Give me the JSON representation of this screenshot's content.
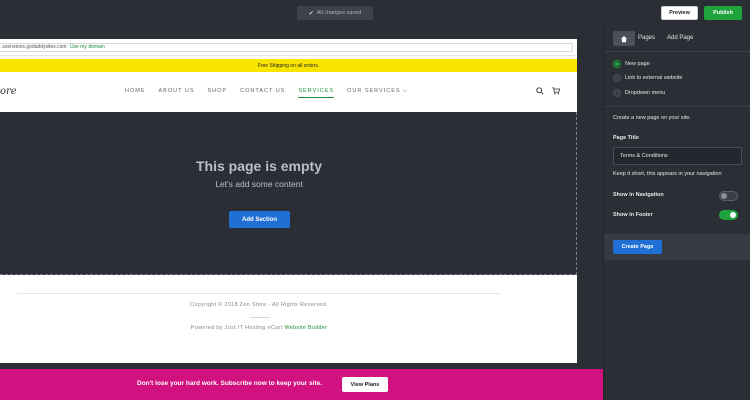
{
  "topbar": {
    "saved_status": "All changes saved",
    "preview_label": "Preview",
    "publish_label": "Publish",
    "publish_color": "#1fa33d"
  },
  "site": {
    "url_text": ".xzenstons.godaddysites.com",
    "url_link": "Use my domain",
    "promo_text": "Free Shipping on all orders.",
    "logo_text": "ore",
    "nav_items": [
      {
        "label": "HOME"
      },
      {
        "label": "ABOUT US"
      },
      {
        "label": "SHOP"
      },
      {
        "label": "CONTACT US"
      },
      {
        "label": "SERVICES",
        "active": true
      },
      {
        "label": "OUR SERVICES",
        "dropdown": true
      }
    ],
    "nav_icons": [
      "search-icon",
      "cart-icon"
    ],
    "empty_title": "This page is empty",
    "empty_subtitle": "Let's add some content",
    "add_section_label": "Add Section",
    "copyright": "Copyright © 2018 Zen Store - All Rights Reserved.",
    "powered_prefix": "Powered by Just IT Hosting eCart",
    "powered_link": "Website Builder",
    "accent_color": "#1a8f3a"
  },
  "banner": {
    "text": "Don't lose your hard work. Subscribe now to keep your site.",
    "button_label": "View Plans",
    "color": "#d0117f"
  },
  "panel": {
    "tabs": {
      "home_icon": "home-icon",
      "pages": "Pages",
      "add_page": "Add Page"
    },
    "options": [
      {
        "label": "New page",
        "selected": true
      },
      {
        "label": "Link to external website",
        "selected": false
      },
      {
        "label": "Dropdown menu",
        "selected": false
      }
    ],
    "description": "Create a new page on your site.",
    "page_title_label": "Page Title",
    "page_title_value": "Terms & Conditions",
    "hint": "Keep it short, this appears in your navigation",
    "show_in_navigation_label": "Show in Navigation",
    "show_in_navigation": false,
    "show_in_footer_label": "Show in Footer",
    "show_in_footer": true,
    "create_label": "Create Page"
  }
}
